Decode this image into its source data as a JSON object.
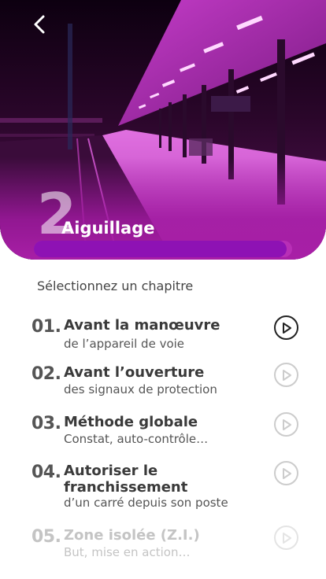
{
  "header": {
    "chapter_number": "2",
    "chapter_title": "Aiguillage",
    "progress_fraction": 0.98,
    "colors": {
      "accent": "#8e12b4",
      "hero_tint": "#b42fae"
    },
    "back_icon": "chevron-left-icon"
  },
  "list": {
    "label": "Sélectionnez un chapitre",
    "chapters": [
      {
        "num": "01.",
        "title": "Avant la manœuvre",
        "subtitle": "de l’appareil de voie",
        "state": "active",
        "icon": "play-circle-icon"
      },
      {
        "num": "02.",
        "title": "Avant l’ouverture",
        "subtitle": "des signaux de protection",
        "state": "normal",
        "icon": "play-circle-icon"
      },
      {
        "num": "03.",
        "title": "Méthode globale",
        "subtitle": "Constat, auto-contrôle…",
        "state": "normal",
        "icon": "play-circle-icon"
      },
      {
        "num": "04.",
        "title": "Autoriser le franchissement",
        "subtitle": "d’un carré depuis son poste",
        "state": "normal",
        "icon": "play-circle-icon"
      },
      {
        "num": "05.",
        "title": "Zone isolée (Z.I.)",
        "subtitle": "But, mise en action…",
        "state": "dim",
        "icon": "play-circle-icon"
      }
    ]
  }
}
